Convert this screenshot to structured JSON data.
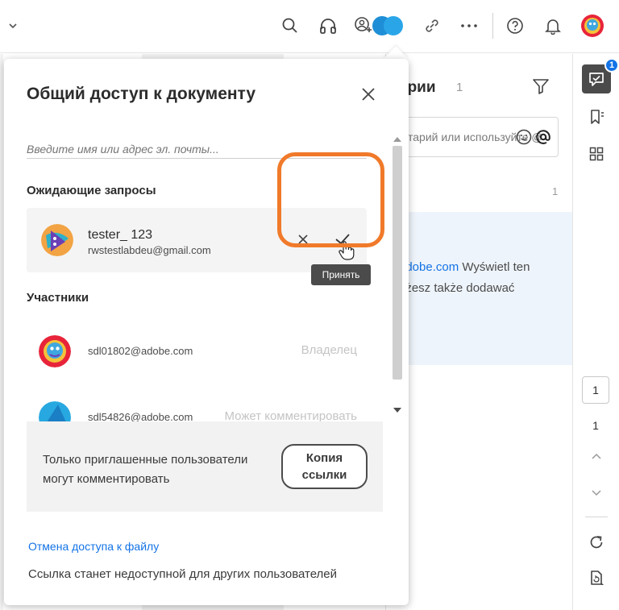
{
  "toolbar": {
    "icons": [
      "chevron-down-icon",
      "search-icon",
      "headphones-icon",
      "add-people-icon",
      "link-icon",
      "more-icon",
      "help-icon",
      "bell-icon",
      "user-avatar"
    ]
  },
  "comments_panel": {
    "title_partial": "арии",
    "count": "1",
    "input_placeholder_partial": "тарий или используйте @",
    "thread_count": "1",
    "notice_link": "adobe.com",
    "notice_line1_rest": " Wyświetl ten",
    "notice_line2": "ożesz także dodawać"
  },
  "rail": {
    "badge": "1",
    "page_current": "1",
    "page_total": "1"
  },
  "dialog": {
    "title": "Общий доступ к документу",
    "input_placeholder": "Введите имя или адрес эл. почты...",
    "pending_title": "Ожидающие запросы",
    "pending": {
      "name": "tester_ 123",
      "email": "rwstestlabdeu@gmail.com"
    },
    "accept_tooltip": "Принять",
    "members_title": "Участники",
    "members": [
      {
        "email": "sdl01802@adobe.com",
        "role": "Владелец"
      },
      {
        "email": "sdl54826@adobe.com",
        "role": "Может комментировать"
      }
    ],
    "permission_text": "Только приглашенные пользователи могут комментировать",
    "copy_link_button": "Копия ссылки",
    "revoke_link": "Отмена доступа к файлу",
    "revoke_note": "Ссылка станет недоступной для других пользователей"
  },
  "colors": {
    "accent_blue": "#1473e6",
    "highlight_orange": "#f07a2a",
    "tooltip_bg": "#4b4b4b"
  }
}
